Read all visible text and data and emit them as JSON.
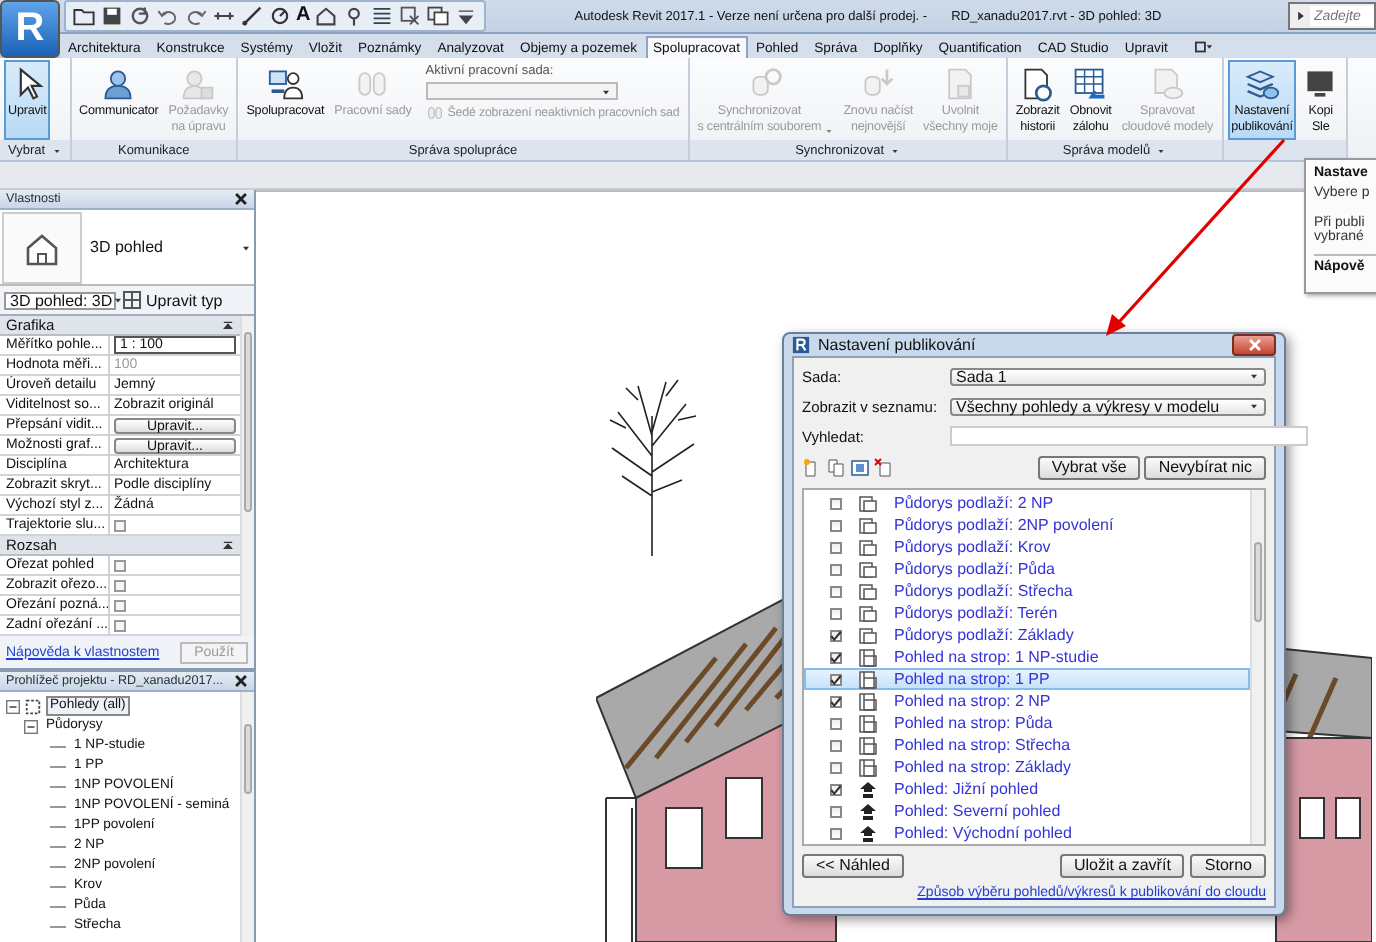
{
  "window": {
    "title": "Autodesk Revit 2017.1 - Verze není určena pro další prodej. -",
    "document": "RD_xanadu2017.rvt - 3D pohled: 3D",
    "search_placeholder": "Zadejte"
  },
  "app_button": {
    "label": "R"
  },
  "quick_access": [
    {
      "kind": "folder"
    },
    {
      "kind": "save"
    },
    {
      "kind": "sync"
    },
    {
      "kind": "undo"
    },
    {
      "kind": "redo"
    },
    {
      "kind": "measure"
    },
    {
      "kind": "dimension"
    },
    {
      "kind": "tag"
    },
    {
      "kind": "glyph",
      "text": "A"
    },
    {
      "kind": "view3d"
    },
    {
      "kind": "section"
    },
    {
      "kind": "thinlines"
    },
    {
      "kind": "close"
    },
    {
      "kind": "windows"
    },
    {
      "kind": "more"
    }
  ],
  "tabs": [
    {
      "label": "Architektura",
      "selected": false
    },
    {
      "label": "Konstrukce",
      "selected": false
    },
    {
      "label": "Systémy",
      "selected": false
    },
    {
      "label": "Vložit",
      "selected": false
    },
    {
      "label": "Poznámky",
      "selected": false
    },
    {
      "label": "Analyzovat",
      "selected": false
    },
    {
      "label": "Objemy a pozemek",
      "selected": false
    },
    {
      "label": "Spolupracovat",
      "selected": true
    },
    {
      "label": "Pohled",
      "selected": false
    },
    {
      "label": "Správa",
      "selected": false
    },
    {
      "label": "Doplňky",
      "selected": false
    },
    {
      "label": "Quantification",
      "selected": false
    },
    {
      "label": "CAD Studio",
      "selected": false
    },
    {
      "label": "Upravit",
      "selected": false
    }
  ],
  "ribbon": [
    {
      "label": "Vybrat",
      "dropdown": true,
      "items": [
        {
          "kind": "large",
          "lines": [
            "Upravit"
          ],
          "selected": true,
          "disabled": false
        }
      ]
    },
    {
      "label": "Komunikace",
      "dropdown": false,
      "items": [
        {
          "kind": "large",
          "lines": [
            "Communicator"
          ],
          "selected": false,
          "disabled": false
        },
        {
          "kind": "large",
          "lines": [
            "Požadavky",
            "na úpravu"
          ],
          "selected": false,
          "disabled": true
        }
      ]
    },
    {
      "label": "Správa spolupráce",
      "dropdown": false,
      "items": [
        {
          "kind": "large",
          "lines": [
            "Spolupracovat"
          ],
          "selected": false,
          "disabled": false
        },
        {
          "kind": "large",
          "lines": [
            "Pracovní sady"
          ],
          "selected": false,
          "disabled": true
        },
        {
          "kind": "combo",
          "label": "Aktivní pracovní sada:",
          "check_label": "Šedé zobrazení neaktivních pracovních sad",
          "disabled": true
        }
      ]
    },
    {
      "label": "Synchronizovat",
      "dropdown": true,
      "items": [
        {
          "kind": "large",
          "lines": [
            "Synchronizovat",
            "s centrálním souborem"
          ],
          "dropdown": true,
          "selected": false,
          "disabled": true
        },
        {
          "kind": "large",
          "lines": [
            "Znovu načíst",
            "nejnovější"
          ],
          "selected": false,
          "disabled": true
        },
        {
          "kind": "large",
          "lines": [
            "Uvolnit",
            "všechny moje"
          ],
          "selected": false,
          "disabled": true
        }
      ]
    },
    {
      "label": "Správa modelů",
      "dropdown": true,
      "items": [
        {
          "kind": "large",
          "lines": [
            "Zobrazit",
            "historii"
          ],
          "selected": false,
          "disabled": false
        },
        {
          "kind": "large",
          "lines": [
            "Obnovit",
            "zálohu"
          ],
          "selected": false,
          "disabled": false
        },
        {
          "kind": "large",
          "lines": [
            "Spravovat",
            "cloudové modely"
          ],
          "selected": false,
          "disabled": true
        }
      ]
    },
    {
      "items": [
        {
          "kind": "large",
          "lines": [
            "Nastavení",
            "publikování"
          ],
          "selected": true,
          "disabled": false
        },
        {
          "kind": "large",
          "lines": [
            "Kopi",
            "Sle"
          ],
          "selected": false,
          "disabled": false
        }
      ]
    }
  ],
  "tooltip": {
    "title": "Nastave",
    "lines": [
      "Vybere p"
    ],
    "note": [
      "Při publi",
      "vybrané"
    ],
    "help": "Nápově"
  },
  "properties": {
    "title": "Vlastnosti",
    "type_name": "3D pohled",
    "instance": "3D pohled: 3D",
    "edit_type": "Upravit typ",
    "groups": [
      {
        "name": "Grafika",
        "rows": [
          {
            "label": "Měřítko pohle...",
            "kind": "input",
            "value": "1 : 100"
          },
          {
            "label": "Hodnota měři...",
            "kind": "text",
            "value": "100",
            "disabled": true
          },
          {
            "label": "Úroveň detailu",
            "kind": "text",
            "value": "Jemný",
            "disabled": false
          },
          {
            "label": "Viditelnost so...",
            "kind": "text",
            "value": "Zobrazit originál",
            "disabled": false
          },
          {
            "label": "Přepsání vidit...",
            "kind": "button",
            "value": "Upravit..."
          },
          {
            "label": "Možnosti graf...",
            "kind": "button",
            "value": "Upravit..."
          },
          {
            "label": "Disciplína",
            "kind": "text",
            "value": "Architektura",
            "disabled": false
          },
          {
            "label": "Zobrazit skryt...",
            "kind": "text",
            "value": "Podle disciplíny",
            "disabled": false
          },
          {
            "label": "Výchozí styl z...",
            "kind": "text",
            "value": "Žádná",
            "disabled": false
          },
          {
            "label": "Trajektorie slu...",
            "kind": "check",
            "checked": false
          }
        ]
      },
      {
        "name": "Rozsah",
        "rows": [
          {
            "label": "Ořezat pohled",
            "kind": "check",
            "checked": false
          },
          {
            "label": "Zobrazit ořezo...",
            "kind": "check",
            "checked": false
          },
          {
            "label": "Ořezání pozná...",
            "kind": "check",
            "checked": false
          },
          {
            "label": "Zadní ořezání ...",
            "kind": "check",
            "checked": false
          }
        ]
      }
    ],
    "help_link": "Nápověda k vlastnostem",
    "apply": "Použít"
  },
  "browser": {
    "title": "Prohlížeč projektu - RD_xanadu2017...",
    "tree": [
      {
        "label": "Pohledy (all)",
        "expanded": true,
        "selected": true,
        "children": [
          {
            "label": "Půdorysy",
            "expanded": true,
            "selected": false,
            "children": [
              {
                "label": "1 NP-studie",
                "selected": false
              },
              {
                "label": "1 PP",
                "selected": false
              },
              {
                "label": "1NP POVOLENÍ",
                "selected": false
              },
              {
                "label": "1NP POVOLENÍ - seminá",
                "selected": false
              },
              {
                "label": "1PP povolení",
                "selected": false
              },
              {
                "label": "2 NP",
                "selected": false
              },
              {
                "label": "2NP povolení",
                "selected": false
              },
              {
                "label": "Krov",
                "selected": false
              },
              {
                "label": "Půda",
                "selected": false
              },
              {
                "label": "Střecha",
                "selected": false
              }
            ]
          }
        ]
      }
    ]
  },
  "dialog": {
    "title": "Nastavení publikování",
    "set_label": "Sada:",
    "set_value": "Sada 1",
    "show_label": "Zobrazit v seznamu:",
    "show_value": "Všechny pohledy a výkresy v modelu",
    "search_label": "Vyhledat:",
    "select_all": "Vybrat vše",
    "select_none": "Nevybírat nic",
    "items": [
      {
        "kind": "plan",
        "label": "Půdorys podlaží: 2 NP",
        "checked": false,
        "selected": false
      },
      {
        "kind": "plan",
        "label": "Půdorys podlaží: 2NP povolení",
        "checked": false,
        "selected": false
      },
      {
        "kind": "plan",
        "label": "Půdorys podlaží: Krov",
        "checked": false,
        "selected": false
      },
      {
        "kind": "plan",
        "label": "Půdorys podlaží: Půda",
        "checked": false,
        "selected": false
      },
      {
        "kind": "plan",
        "label": "Půdorys podlaží: Střecha",
        "checked": false,
        "selected": false
      },
      {
        "kind": "plan",
        "label": "Půdorys podlaží: Terén",
        "checked": false,
        "selected": false
      },
      {
        "kind": "plan",
        "label": "Půdorys podlaží: Základy",
        "checked": true,
        "selected": false
      },
      {
        "kind": "ceiling",
        "label": "Pohled na strop: 1 NP-studie",
        "checked": true,
        "selected": false
      },
      {
        "kind": "ceiling",
        "label": "Pohled na strop: 1 PP",
        "checked": true,
        "selected": true
      },
      {
        "kind": "ceiling",
        "label": "Pohled na strop: 2 NP",
        "checked": true,
        "selected": false
      },
      {
        "kind": "ceiling",
        "label": "Pohled na strop: Půda",
        "checked": false,
        "selected": false
      },
      {
        "kind": "ceiling",
        "label": "Pohled na strop: Střecha",
        "checked": false,
        "selected": false
      },
      {
        "kind": "ceiling",
        "label": "Pohled na strop: Základy",
        "checked": false,
        "selected": false
      },
      {
        "kind": "elevation",
        "label": "Pohled: Jižní pohled",
        "checked": true,
        "selected": false
      },
      {
        "kind": "elevation",
        "label": "Pohled: Severní pohled",
        "checked": false,
        "selected": false
      },
      {
        "kind": "elevation",
        "label": "Pohled: Východní pohled",
        "checked": false,
        "selected": false
      }
    ],
    "preview": "<< Náhled",
    "save": "Uložit a zavřít",
    "cancel": "Storno",
    "link": "Způsob výběru pohledů/výkresů k publikování do cloudu"
  }
}
